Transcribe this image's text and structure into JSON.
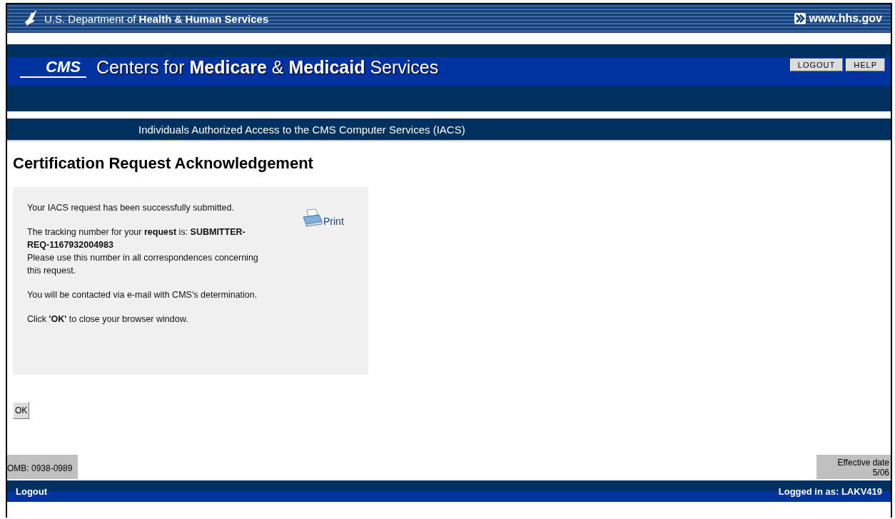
{
  "hhs_bar": {
    "title": "U.S. Department of **Health & Human Services**",
    "link": "www.hhs.gov"
  },
  "banner": {
    "logo": "CMS",
    "title": "Centers for **Medicare** & **Medicaid** Services",
    "buttons": [
      "LOGOUT",
      "HELP"
    ]
  },
  "subtitle_bar": "Individuals Authorized Access to the CMS Computer Services (IACS)",
  "page_title": "Certification Request Acknowledgement",
  "message_box": {
    "print_link": "Print",
    "paragraphs": [
      {
        "lines": [
          "Your IACS request has been successfully submitted."
        ]
      },
      {
        "lines": [
          "The tracking number for your **request** is: **SUBMITTER-REQ-1167932004983**",
          "Please use this number in all correspondences concerning this request."
        ]
      },
      {
        "lines": [
          "You will be contacted via e-mail with CMS's determination."
        ]
      },
      {
        "lines": [
          "Click **'OK'** to close your browser window."
        ]
      }
    ]
  },
  "ok_button": "OK",
  "footer": {
    "omb": "OMB: 0938-0989",
    "effective_date": [
      "Effective date",
      "5/06"
    ],
    "logout_link": "Logout",
    "logged_in": "Logged in as: LAKV419"
  }
}
